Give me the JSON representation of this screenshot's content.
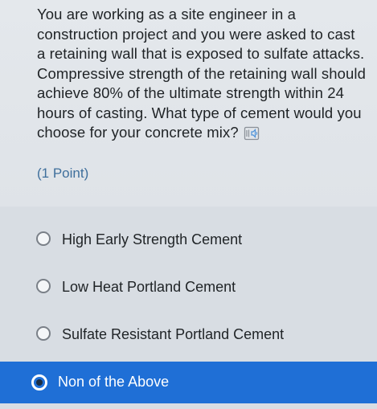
{
  "question": {
    "text": "You are working as a site engineer in a construction project and you were asked to cast a retaining wall that is exposed to sulfate attacks. Compressive strength of the retaining wall should achieve 80% of the ultimate strength within 24 hours of casting. What type of cement would you choose for your concrete mix?",
    "points": "(1 Point)",
    "reader_icon": "immersive-reader-icon"
  },
  "options": [
    {
      "label": "High Early Strength Cement",
      "selected": false
    },
    {
      "label": "Low Heat Portland Cement",
      "selected": false
    },
    {
      "label": "Sulfate Resistant Portland Cement",
      "selected": false
    },
    {
      "label": "Non of the Above",
      "selected": true
    }
  ],
  "colors": {
    "accent": "#1f6fd6",
    "points_text": "#3f6f9c"
  }
}
